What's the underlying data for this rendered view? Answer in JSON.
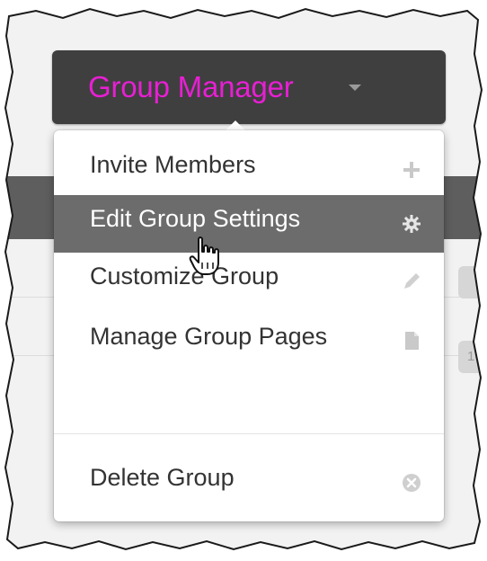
{
  "header": {
    "title": "Group Manager",
    "title_color": "#e81fd4",
    "caret_icon": "chevron-down-icon"
  },
  "menu": {
    "items": [
      {
        "label": "Invite Members",
        "icon": "plus-icon",
        "active": false
      },
      {
        "label": "Edit Group Settings",
        "icon": "gear-icon",
        "active": true
      },
      {
        "label": "Customize Group",
        "icon": "pencil-icon",
        "active": false
      },
      {
        "label": "Manage Group Pages",
        "icon": "page-icon",
        "active": false
      },
      {
        "label": "Delete Group",
        "icon": "close-circle-icon",
        "active": false
      }
    ]
  },
  "background": {
    "badge_text": "1"
  },
  "colors": {
    "button_bg": "#3f3f3f",
    "active_item_bg": "#6c6c6c"
  }
}
